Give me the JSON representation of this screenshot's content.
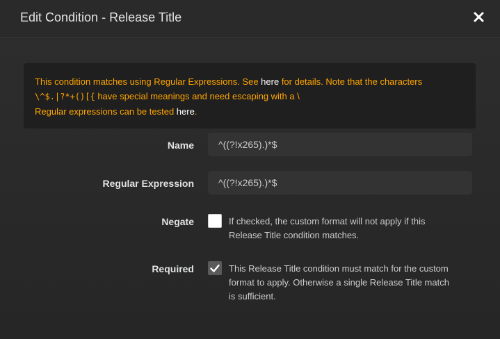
{
  "modal": {
    "title": "Edit Condition - Release Title",
    "close_icon": "close-icon"
  },
  "alert": {
    "line1_before": "This condition matches using Regular Expressions. See ",
    "line1_link": "here",
    "line1_after": " for details. Note that the characters",
    "line2_chars": "\\^$.|?*+()[{",
    "line2_after": " have special meanings and need escaping with a \\",
    "line3_before": "Regular expressions can be tested ",
    "line3_link": "here",
    "line3_after": "."
  },
  "form": {
    "name": {
      "label": "Name",
      "value": "^((?!x265).)*$"
    },
    "regex": {
      "label": "Regular Expression",
      "value": "^((?!x265).)*$"
    },
    "negate": {
      "label": "Negate",
      "checked": false,
      "help_line1": "If checked, the custom format will not apply if this",
      "help_line2": "Release Title condition matches."
    },
    "required": {
      "label": "Required",
      "checked": true,
      "check_icon": "checkmark-icon",
      "help_line1": "This Release Title condition must match for the custom",
      "help_line2": "format to apply. Otherwise a single Release Title match",
      "help_line3": "is sufficient."
    }
  },
  "colors": {
    "background": "#2a2a2a",
    "alert_text": "#ffa500",
    "link": "#ffffff",
    "input_bg": "#333333"
  }
}
